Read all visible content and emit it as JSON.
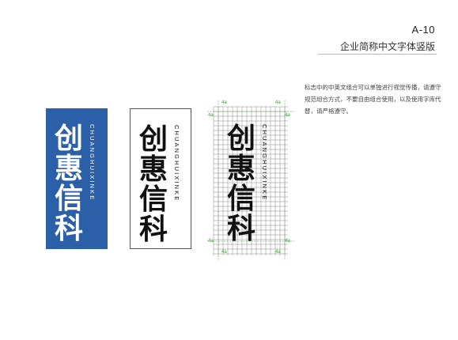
{
  "header": {
    "page_code": "A-10",
    "page_title": "企业简称中文字体竖版"
  },
  "description": "标志中的中英文组合可以单独进行视觉传播，请遵守规范组合方式，不要自由组合使用，以及使用字库代替，请严格遵守。",
  "logo": {
    "chars": [
      "创",
      "惠",
      "信",
      "科"
    ],
    "english": "CHUANGHUIXINKE"
  },
  "grid": {
    "unit_label": "4a"
  },
  "colors": {
    "brand": "#2b5fa8",
    "accent": "#3a9a3a"
  }
}
